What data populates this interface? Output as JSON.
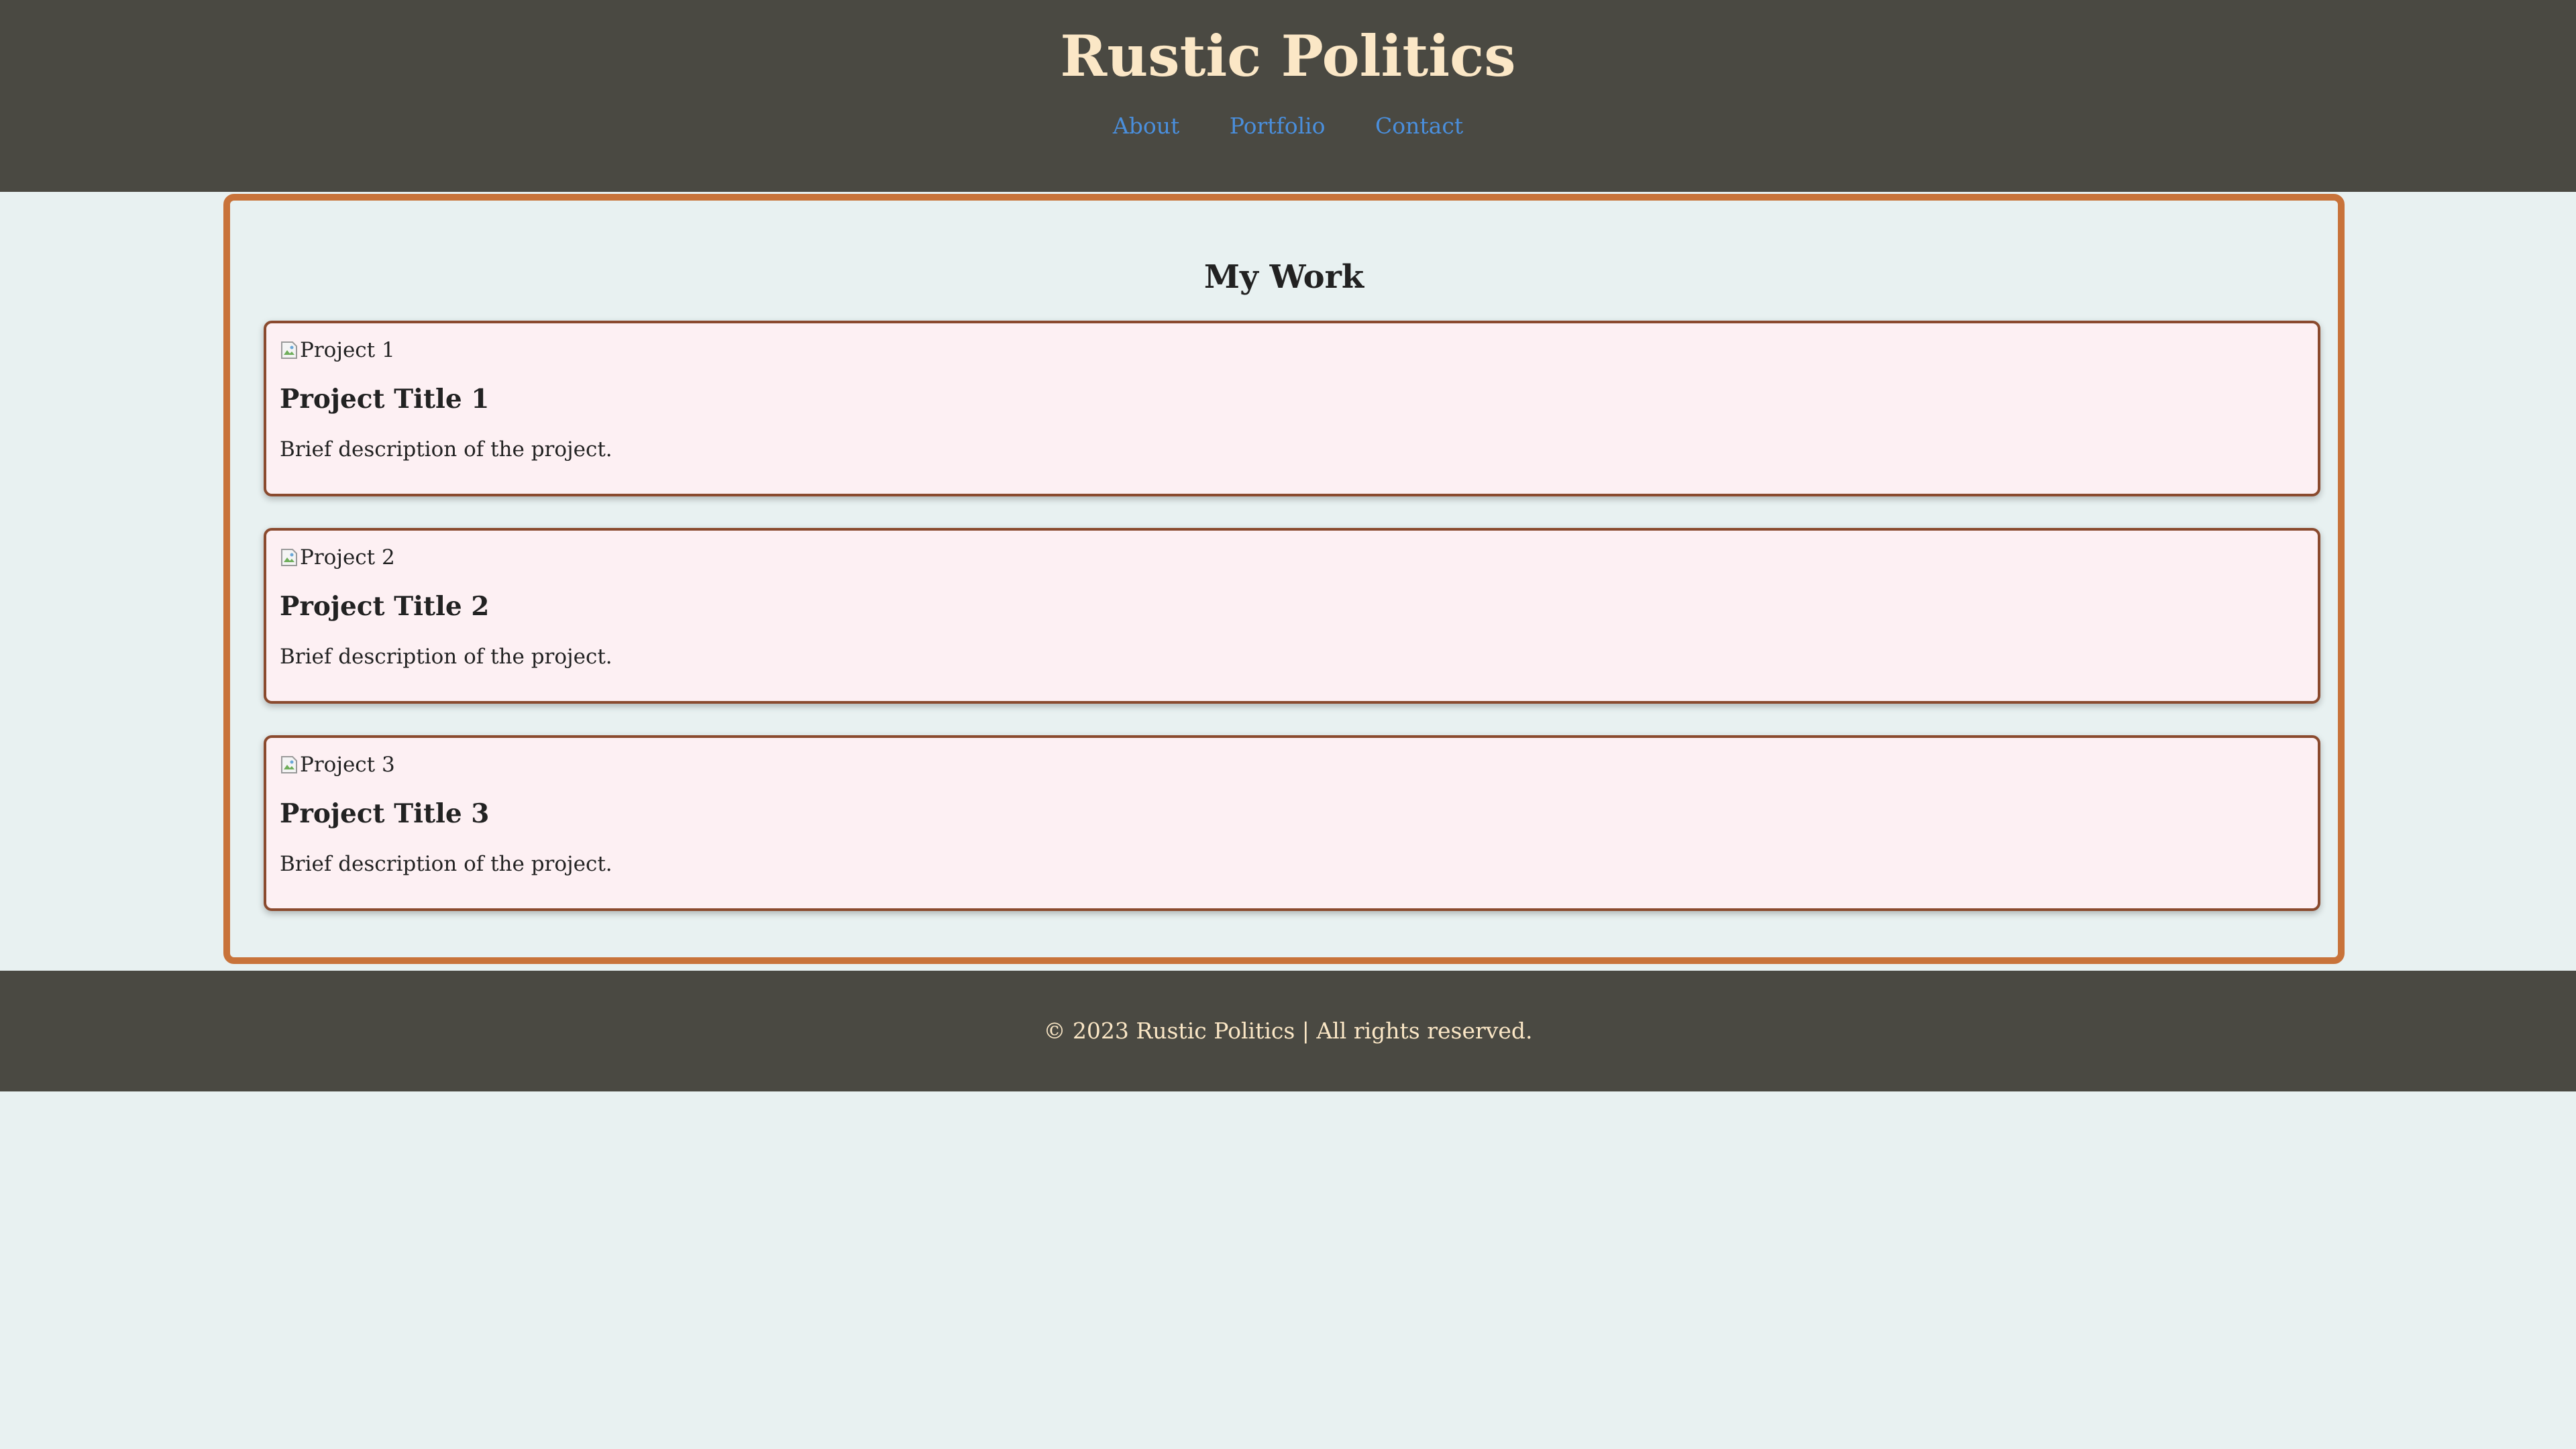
{
  "header": {
    "title": "Rustic Politics",
    "nav": [
      {
        "label": "About"
      },
      {
        "label": "Portfolio"
      },
      {
        "label": "Contact"
      }
    ]
  },
  "main": {
    "section_title": "My Work",
    "projects": [
      {
        "image_alt": "Project 1",
        "title": "Project Title 1",
        "description": "Brief description of the project."
      },
      {
        "image_alt": "Project 2",
        "title": "Project Title 2",
        "description": "Brief description of the project."
      },
      {
        "image_alt": "Project 3",
        "title": "Project Title 3",
        "description": "Brief description of the project."
      }
    ]
  },
  "footer": {
    "text": "© 2023 Rustic Politics | All rights reserved."
  },
  "colors": {
    "header_bg": "#4a4942",
    "title_color": "#fbe7c6",
    "link_color": "#4a8fdd",
    "card_border": "#c8733a",
    "project_border": "#8a4a2e",
    "project_bg": "#fdf0f3",
    "page_bg": "#e8f1f1"
  }
}
